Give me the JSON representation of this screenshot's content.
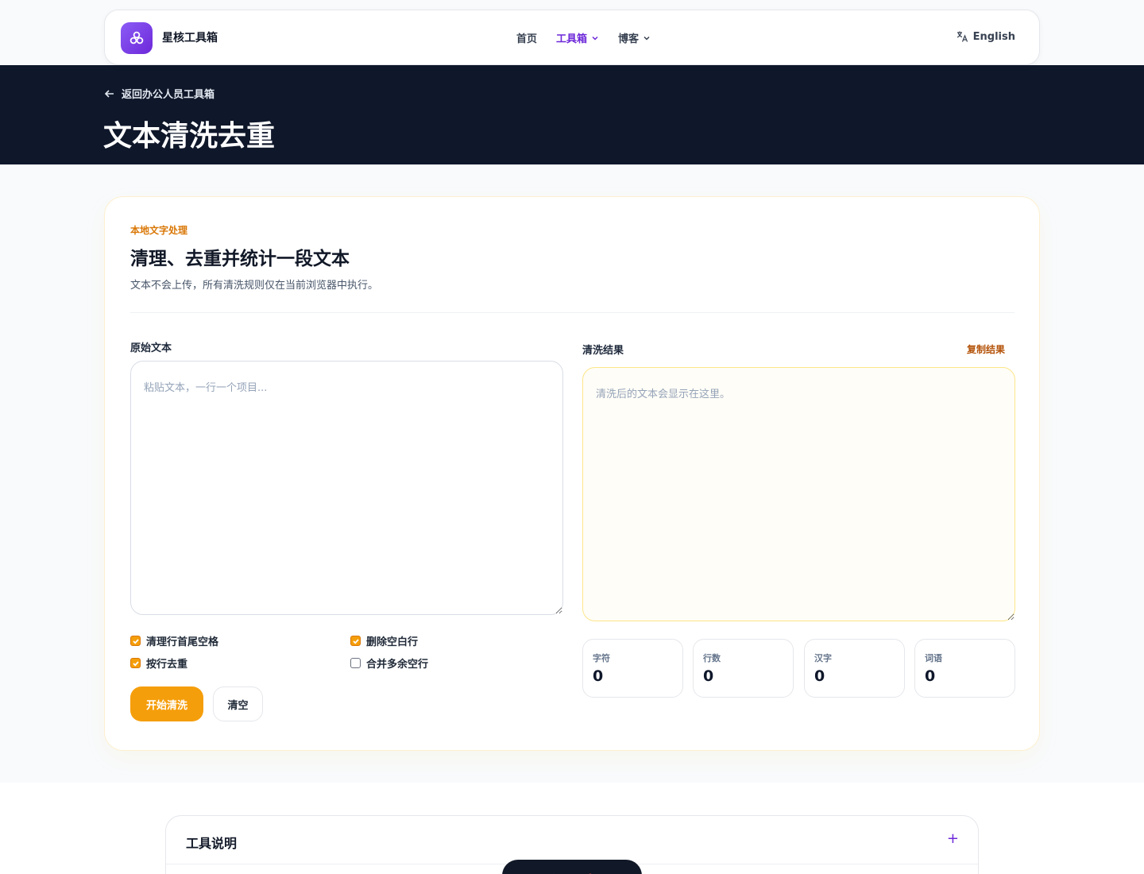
{
  "header": {
    "brand": "星核工具箱",
    "nav": [
      {
        "label": "首页",
        "active": false,
        "dropdown": false
      },
      {
        "label": "工具箱",
        "active": true,
        "dropdown": true
      },
      {
        "label": "博客",
        "active": false,
        "dropdown": true
      }
    ],
    "language": "English"
  },
  "hero": {
    "back_link": "返回办公人员工具箱",
    "title": "文本清洗去重"
  },
  "card": {
    "eyebrow": "本地文字处理",
    "title": "清理、去重并统计一段文本",
    "description": "文本不会上传，所有清洗规则仅在当前浏览器中执行。",
    "input": {
      "label": "原始文本",
      "placeholder": "粘贴文本，一行一个项目..."
    },
    "output": {
      "label": "清洗结果",
      "copy_label": "复制结果",
      "placeholder": "清洗后的文本会显示在这里。"
    },
    "options": [
      {
        "label": "清理行首尾空格",
        "checked": true
      },
      {
        "label": "删除空白行",
        "checked": true
      },
      {
        "label": "按行去重",
        "checked": true
      },
      {
        "label": "合并多余空行",
        "checked": false
      }
    ],
    "buttons": {
      "start": "开始清洗",
      "clear": "清空"
    },
    "stats": [
      {
        "label": "字符",
        "value": "0"
      },
      {
        "label": "行数",
        "value": "0"
      },
      {
        "label": "汉字",
        "value": "0"
      },
      {
        "label": "词语",
        "value": "0"
      }
    ]
  },
  "accordion": {
    "title": "工具说明",
    "toggle": "+"
  },
  "colors": {
    "accent": "#6d28d9",
    "primary_button": "#f59e0b",
    "hero_bg": "#0f172a",
    "eyebrow": "#d97706"
  }
}
